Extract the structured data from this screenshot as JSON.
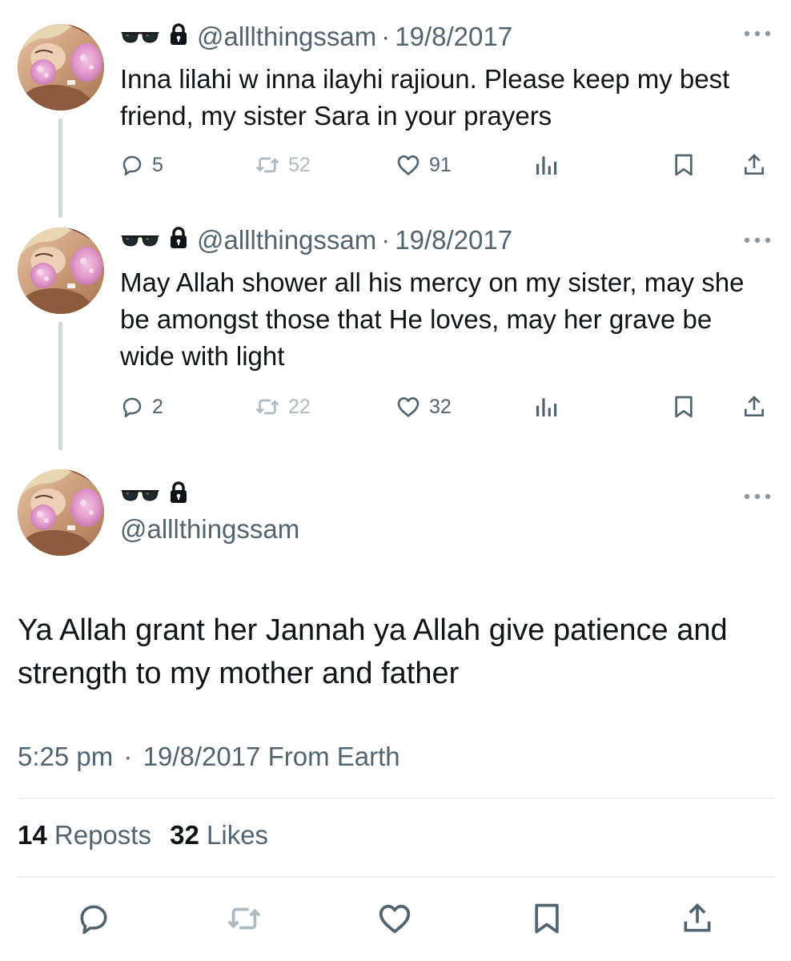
{
  "tweets": [
    {
      "handle": "@alllthingssam",
      "separator": "·",
      "date": "19/8/2017",
      "text": "Inna lilahi w inna ilayhi rajioun. Please keep my best friend, my sister Sara in your prayers",
      "replies": "5",
      "reposts": "52",
      "likes": "91"
    },
    {
      "handle": "@alllthingssam",
      "separator": "·",
      "date": "19/8/2017",
      "text": "May Allah shower all his mercy on my sister, may she be amongst those that He loves, may her grave be wide with light",
      "replies": "2",
      "reposts": "22",
      "likes": "32"
    }
  ],
  "main_tweet": {
    "handle": "@alllthingssam",
    "text": "Ya Allah grant her Jannah ya Allah give patience and strength to my mother and father",
    "time": "5:25 pm",
    "separator": "·",
    "date": "19/8/2017",
    "source": "From Earth",
    "reposts_count": "14",
    "reposts_label": "Reposts",
    "likes_count": "32",
    "likes_label": "Likes"
  },
  "icons": {
    "name_emoji": "sunglasses-icon",
    "protected": "lock-icon",
    "more": "more-dots-icon",
    "reply": "reply-icon",
    "repost": "repost-icon",
    "like": "heart-icon",
    "views": "analytics-icon",
    "bookmark": "bookmark-icon",
    "share": "share-icon"
  },
  "colors": {
    "text": "#0f1419",
    "secondary": "#536471",
    "disabled": "#aebac3",
    "divider": "#eff3f4",
    "thread_line": "#cfd9de"
  }
}
